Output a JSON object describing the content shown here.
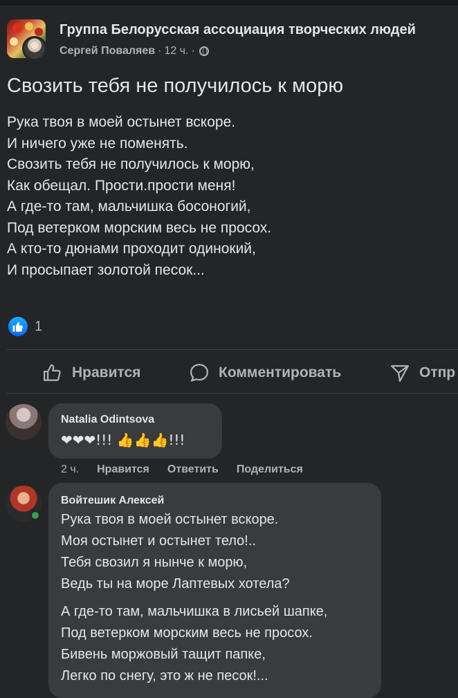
{
  "post": {
    "group_name": "Группа Белорусская ассоциация творческих людей",
    "author": "Сергей Поваляев",
    "time": "12 ч.",
    "separator": "·",
    "title": "Свозить тебя не получилось к морю",
    "poem_lines": [
      "Рука твоя в моей остынет вскоре.",
      "И ничего уже не поменять.",
      "Свозить тебя не получилось к морю,",
      "Как обещал. Прости.прости меня!",
      "А где-то там, мальчишка босоногий,",
      "Под ветерком морским весь не просох.",
      "А кто-то дюнами проходит одинокий,",
      "И просыпает золотой песок..."
    ],
    "reaction_count": "1"
  },
  "actions": {
    "like": "Нравится",
    "comment": "Комментировать",
    "share": "Отпр"
  },
  "comments": [
    {
      "name": "Natalia Odintsova",
      "text": "❤❤❤!!! 👍👍👍!!!",
      "time": "2 ч.",
      "like": "Нравится",
      "reply": "Ответить",
      "share": "Поделиться"
    },
    {
      "name": "Войтешик Алексей",
      "lines": [
        "Рука твоя в моей остынет вскоре.",
        "Моя остынет и остынет тело!..",
        "Тебя свозил я нынче к морю,",
        "Ведь ты на море Лаптевых хотела?",
        "А где-то там, мальчишка в лисьей шапке,",
        "Под ветерком морским весь не просох.",
        "Бивень моржовый тащит папке,",
        "Легко по снегу, это ж не песок!..."
      ]
    }
  ],
  "colors": {
    "background": "#242526",
    "bubble": "#3a3b3c",
    "like_blue": "#0866ff",
    "online_green": "#31a24c"
  }
}
